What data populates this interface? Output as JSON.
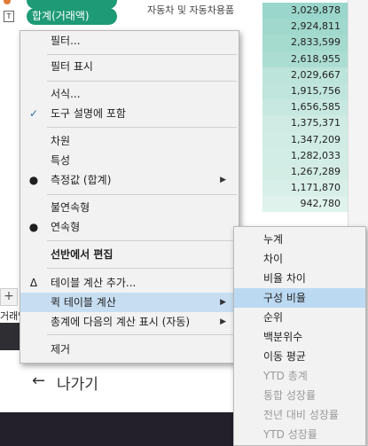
{
  "workspace": {
    "pill_top_label": "",
    "pill_label": "합계(거래액)",
    "tag_letter": "T",
    "tab_plus": "+",
    "tab_label": "거래액",
    "exit_arrow": "←",
    "exit_label": "나가기",
    "accent_color": "#1e9a76"
  },
  "table": {
    "rows": [
      {
        "category": "자동차 및 자동차용품",
        "value": "3,029,878",
        "shade": "#9ad6cb"
      },
      {
        "category": "",
        "value": "2,924,811",
        "shade": "#a0d8cd"
      },
      {
        "category": "",
        "value": "2,833,599",
        "shade": "#a5dacf"
      },
      {
        "category": "",
        "value": "2,618,955",
        "shade": "#acddd3"
      },
      {
        "category": "",
        "value": "2,029,667",
        "shade": "#bde4da"
      },
      {
        "category": "",
        "value": "1,915,756",
        "shade": "#c0e5dc"
      },
      {
        "category": "",
        "value": "1,656,585",
        "shade": "#c7e8e0"
      },
      {
        "category": "",
        "value": "1,375,371",
        "shade": "#cfebe3"
      },
      {
        "category": "",
        "value": "1,347,209",
        "shade": "#d0ece4"
      },
      {
        "category": "",
        "value": "1,282,033",
        "shade": "#d2ede5"
      },
      {
        "category": "",
        "value": "1,267,289",
        "shade": "#d3ede5"
      },
      {
        "category": "",
        "value": "1,171,870",
        "shade": "#d7efe8"
      },
      {
        "category": "",
        "value": "942,780",
        "shade": "#dff2ec"
      }
    ]
  },
  "menu": {
    "items": [
      {
        "label": "필터...",
        "check": "",
        "submenu": false,
        "bold": false
      },
      {
        "label": "필터 표시",
        "check": "",
        "submenu": false,
        "bold": false
      },
      {
        "label": "서식...",
        "check": "",
        "submenu": false,
        "bold": false
      },
      {
        "label": "도구 설명에 포함",
        "check": "✓",
        "submenu": false,
        "bold": false
      },
      {
        "label": "차원",
        "check": "",
        "submenu": false,
        "bold": false
      },
      {
        "label": "특성",
        "check": "",
        "submenu": false,
        "bold": false
      },
      {
        "label": "측정값 (합계)",
        "check": "●",
        "submenu": true,
        "bold": false
      },
      {
        "label": "불연속형",
        "check": "",
        "submenu": false,
        "bold": false
      },
      {
        "label": "연속형",
        "check": "●",
        "submenu": false,
        "bold": false
      },
      {
        "label": "선반에서 편집",
        "check": "",
        "submenu": false,
        "bold": true
      },
      {
        "label": "테이블 계산 추가...",
        "check": "Δ",
        "submenu": false,
        "bold": false
      },
      {
        "label": "퀵 테이블 계산",
        "check": "",
        "submenu": true,
        "bold": false
      },
      {
        "label": "총계에 다음의 계산 표시 (자동)",
        "check": "",
        "submenu": true,
        "bold": false
      },
      {
        "label": "제거",
        "check": "",
        "submenu": false,
        "bold": false
      }
    ],
    "submenu_arrow": "▶"
  },
  "submenu": {
    "items": [
      {
        "label": "누계",
        "disabled": false
      },
      {
        "label": "차이",
        "disabled": false
      },
      {
        "label": "비율 차이",
        "disabled": false
      },
      {
        "label": "구성 비율",
        "disabled": false
      },
      {
        "label": "순위",
        "disabled": false
      },
      {
        "label": "백분위수",
        "disabled": false
      },
      {
        "label": "이동 평균",
        "disabled": false
      },
      {
        "label": "YTD 총계",
        "disabled": true
      },
      {
        "label": "통합 성장률",
        "disabled": true
      },
      {
        "label": "전년 대비 성장률",
        "disabled": true
      },
      {
        "label": "YTD 성장률",
        "disabled": true
      }
    ]
  }
}
